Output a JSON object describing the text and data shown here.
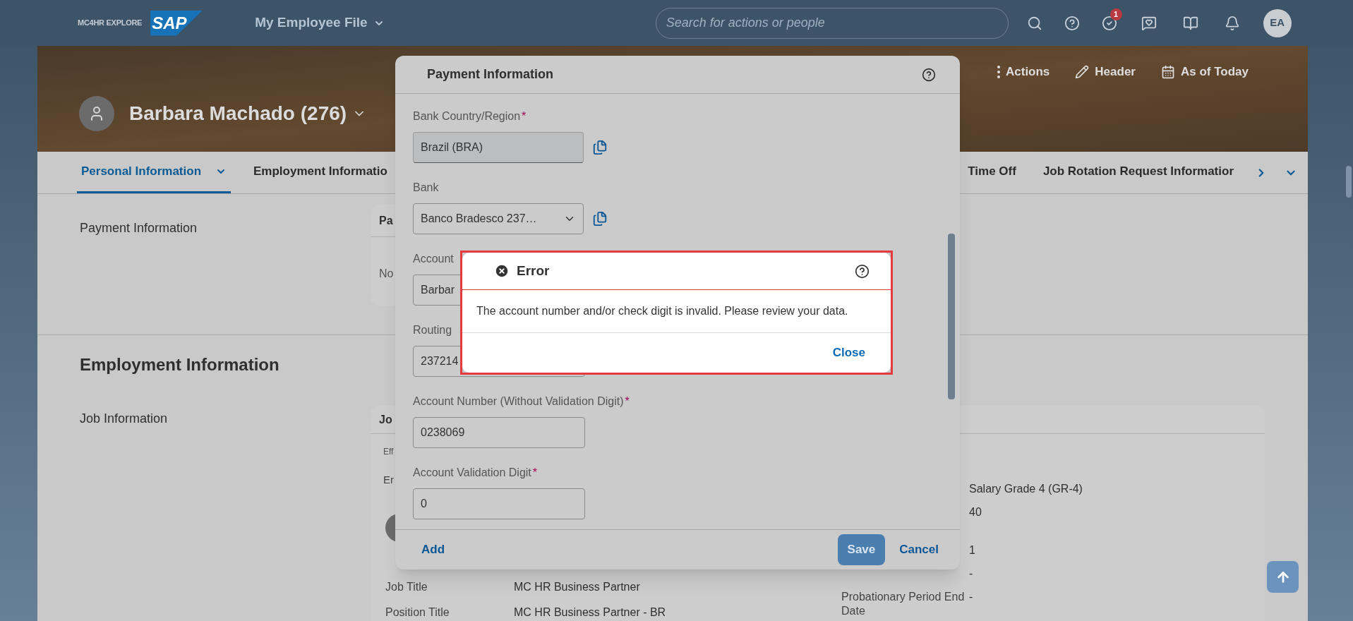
{
  "shell": {
    "logo_text": "MC4HR EXPLORE",
    "brand": "SAP",
    "app_title": "My Employee File",
    "search": {
      "placeholder": "Search for actions or people"
    },
    "todo_badge": "1",
    "avatar_initials": "EA"
  },
  "profile": {
    "name": "Barbara Machado (276)",
    "actions": [
      {
        "kind": "more",
        "label": "Actions"
      },
      {
        "kind": "edit",
        "label": "Header"
      },
      {
        "kind": "calendar",
        "label": "As of Today"
      }
    ]
  },
  "tabs": [
    {
      "label": "Personal Information",
      "selected": true,
      "has_menu": true
    },
    {
      "label": "Employment Informatio",
      "selected": false,
      "has_menu": false
    },
    {
      "label": "Time Off",
      "selected": false,
      "has_menu": false
    },
    {
      "label": "Job Rotation Request Informatior",
      "selected": false,
      "has_menu": false
    }
  ],
  "payment_section": {
    "label": "Payment Information",
    "card_title": "Pa",
    "card_text": "No"
  },
  "employment_section": {
    "title": "Employment Information",
    "label": "Job Information",
    "card_title": "Jo",
    "effective": "Eff",
    "employee": "Er",
    "left_rows": [
      {
        "label": "Job Title",
        "value": "MC HR Business Partner"
      },
      {
        "label": "Position Title",
        "value": "MC HR Business Partner - BR"
      }
    ],
    "right_rows": [
      {
        "value": "Salary Grade 4 (GR-4)"
      },
      {
        "value": "40"
      },
      {
        "value": "1"
      },
      {
        "value": "-"
      },
      {
        "label": "Probationary Period End Date",
        "value": "-"
      }
    ]
  },
  "payment_dialog": {
    "title": "Payment Information",
    "fields": [
      {
        "kind": "readonly",
        "label": "Bank Country/Region",
        "required_mark": "*",
        "value": "Brazil (BRA)",
        "copy_icon": true
      },
      {
        "kind": "select",
        "label": "Bank",
        "value": "Banco Bradesco 237…",
        "copy_icon": true
      },
      {
        "kind": "text",
        "label": "Account",
        "value": "Barbar"
      },
      {
        "kind": "text",
        "label": "Routing",
        "value": "237214"
      },
      {
        "kind": "text",
        "label": "Account Number (Without Validation Digit)",
        "required_mark": "*",
        "value": "0238069",
        "copy_icon": false
      },
      {
        "kind": "text",
        "label": "Account Validation Digit",
        "required_mark": "*",
        "value": "0",
        "copy_icon": false
      }
    ],
    "add": "Add",
    "save": "Save",
    "cancel": "Cancel"
  },
  "error_dialog": {
    "title": "Error",
    "message": "The account number and/or check digit is invalid. Please review your data.",
    "close": "Close"
  }
}
